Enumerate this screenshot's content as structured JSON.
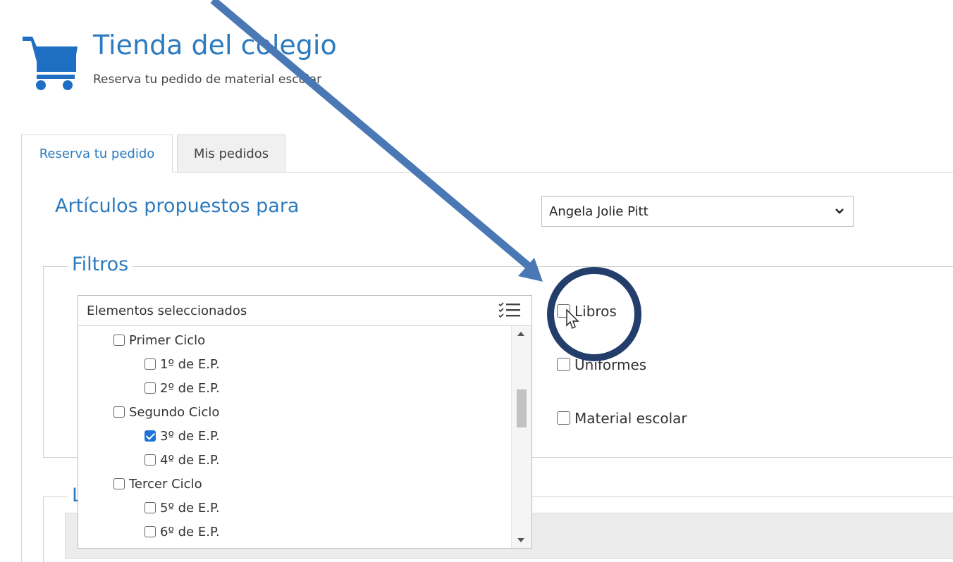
{
  "header": {
    "title": "Tienda del colegio",
    "subtitle": "Reserva tu pedido de material escolar",
    "icon": "shopping-cart-icon",
    "accent_color": "#2c7bbf"
  },
  "tabs": [
    {
      "label": "Reserva tu pedido",
      "active": true
    },
    {
      "label": "Mis pedidos",
      "active": false
    }
  ],
  "main": {
    "heading": "Artículos propuestos para",
    "student_select": {
      "value": "Angela Jolie Pitt"
    }
  },
  "filters": {
    "legend": "Filtros",
    "multiselect": {
      "header": "Elementos seleccionados",
      "options": [
        {
          "label": "Primer Ciclo",
          "checked": false,
          "level": 0
        },
        {
          "label": "1º de E.P.",
          "checked": false,
          "level": 1
        },
        {
          "label": "2º de E.P.",
          "checked": false,
          "level": 1
        },
        {
          "label": "Segundo Ciclo",
          "checked": false,
          "level": 0
        },
        {
          "label": "3º de E.P.",
          "checked": true,
          "level": 1
        },
        {
          "label": "4º de E.P.",
          "checked": false,
          "level": 1
        },
        {
          "label": "Tercer Ciclo",
          "checked": false,
          "level": 0
        },
        {
          "label": "5º de E.P.",
          "checked": false,
          "level": 1
        },
        {
          "label": "6º de E.P.",
          "checked": false,
          "level": 1
        }
      ]
    },
    "categories": [
      {
        "label": "Libros",
        "checked": false
      },
      {
        "label": "Uniformes",
        "checked": false
      },
      {
        "label": "Material escolar",
        "checked": false
      }
    ]
  },
  "lower_section": {
    "legend": "L"
  },
  "annotation": {
    "arrow_color": "#4a78b5",
    "circle_color": "#243e6b"
  }
}
